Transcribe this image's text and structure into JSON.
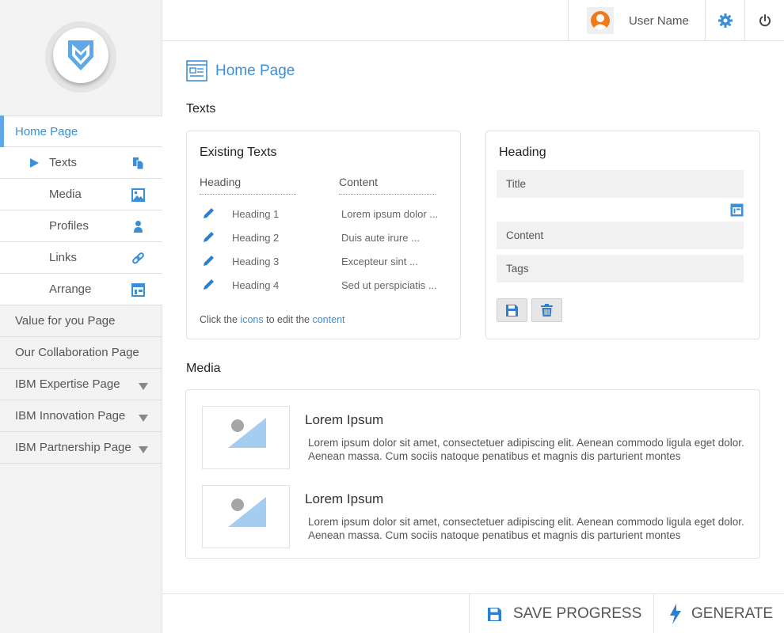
{
  "colors": {
    "accent": "#3b8fd9",
    "accent_light": "#5fa8e8",
    "sidebar_bg": "#f3f3f3",
    "field_bg": "#f1f1f1",
    "avatar": "#f07a1a"
  },
  "header": {
    "user_name": "User Name",
    "icons": [
      "user-avatar-icon",
      "gear-icon",
      "power-icon"
    ]
  },
  "sidebar": {
    "logo": "shield-logo",
    "items": [
      {
        "label": "Home Page",
        "active": true
      },
      {
        "label": "Texts",
        "sub": true,
        "selected": true,
        "icon": "documents-icon"
      },
      {
        "label": "Media",
        "sub": true,
        "icon": "image-icon"
      },
      {
        "label": "Profiles",
        "sub": true,
        "icon": "person-icon"
      },
      {
        "label": "Links",
        "sub": true,
        "icon": "link-icon"
      },
      {
        "label": "Arrange",
        "sub": true,
        "icon": "layout-icon"
      },
      {
        "label": "Value for you Page"
      },
      {
        "label": "Our Collaboration Page"
      },
      {
        "label": "IBM Expertise Page",
        "expandable": true
      },
      {
        "label": "IBM Innovation Page",
        "expandable": true
      },
      {
        "label": "IBM Partnership Page",
        "expandable": true
      }
    ]
  },
  "main": {
    "page_title": "Home Page",
    "texts_section": {
      "title": "Texts",
      "existing": {
        "title": "Existing Texts",
        "columns": [
          "Heading",
          "Content"
        ],
        "rows": [
          {
            "heading": "Heading 1",
            "content": "Lorem ipsum dolor ..."
          },
          {
            "heading": "Heading 2",
            "content": "Duis aute irure ..."
          },
          {
            "heading": "Heading 3",
            "content": "Excepteur sint ..."
          },
          {
            "heading": "Heading 4",
            "content": "Sed ut perspiciatis ..."
          }
        ],
        "hint": {
          "pre": "Click the",
          "link1": "icons",
          "mid": "to edit the",
          "link2": "content"
        }
      },
      "editor": {
        "title": "Heading",
        "title_placeholder": "Title",
        "content_placeholder": "Content",
        "tags_placeholder": "Tags"
      }
    },
    "media_section": {
      "title": "Media",
      "items": [
        {
          "title": "Lorem Ipsum",
          "text": "Lorem ipsum dolor sit amet, consectetuer adipiscing elit. Aenean commodo ligula eget dolor. Aenean massa. Cum sociis natoque penatibus et magnis dis parturient montes"
        },
        {
          "title": "Lorem Ipsum",
          "text": "Lorem ipsum dolor sit amet, consectetuer adipiscing elit. Aenean commodo ligula eget dolor. Aenean massa. Cum sociis natoque penatibus et magnis dis parturient montes"
        }
      ]
    }
  },
  "footer": {
    "save_label": "SAVE PROGRESS",
    "generate_label": "GENERATE"
  }
}
